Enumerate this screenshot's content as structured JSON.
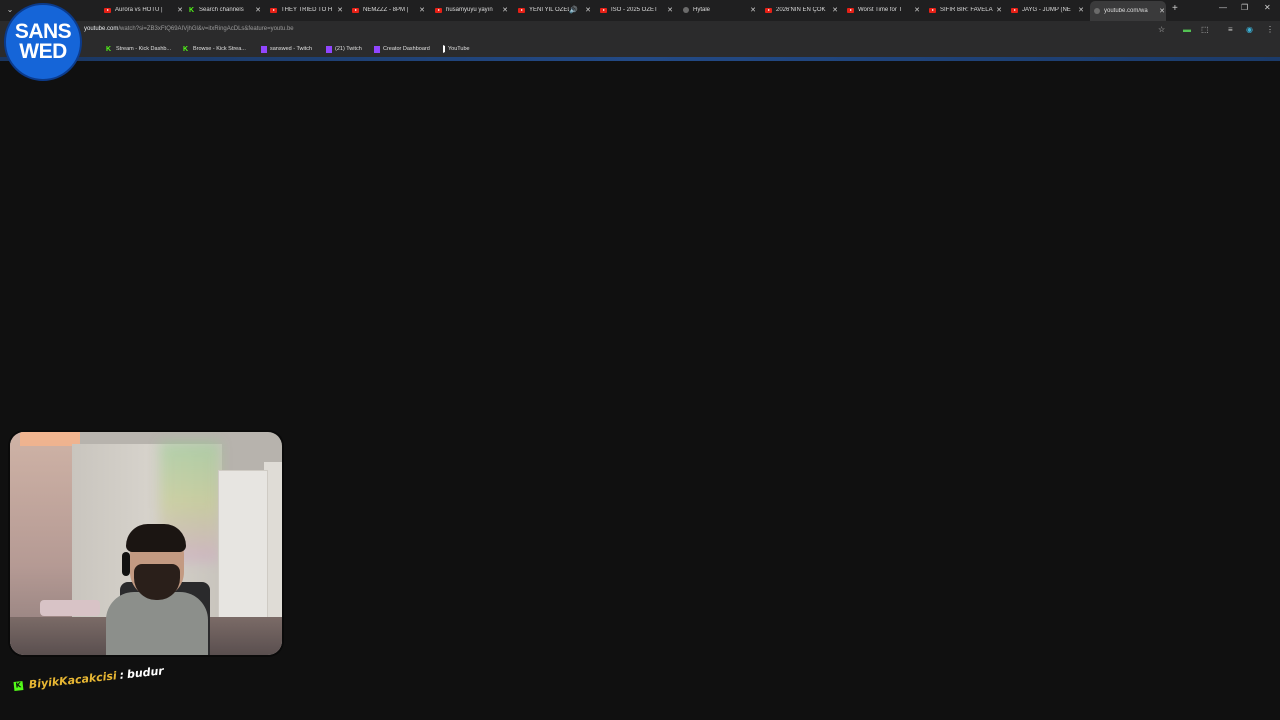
{
  "browser": {
    "tabs": [
      {
        "title": "Aurora vs HOTU |",
        "icon": "youtube-icon"
      },
      {
        "title": "Search channels",
        "icon": "kick-icon"
      },
      {
        "title": "THEY TRIED TO H",
        "icon": "youtube-icon"
      },
      {
        "title": "NEMZZZ - 8PM |",
        "icon": "youtube-icon"
      },
      {
        "title": "husamyuyu yayın",
        "icon": "youtube-icon"
      },
      {
        "title": "YENİ YIL ÖZEL",
        "icon": "youtube-icon",
        "audio": true
      },
      {
        "title": "İSO - 2025 ÖZET",
        "icon": "youtube-icon"
      },
      {
        "title": "Hytale",
        "icon": "hytale-icon"
      },
      {
        "title": "2026'NIN EN ÇOK",
        "icon": "youtube-icon"
      },
      {
        "title": "Worst Time for T",
        "icon": "youtube-icon"
      },
      {
        "title": "SIFIR BİR: FAVELA",
        "icon": "youtube-icon"
      },
      {
        "title": "JAYG - JUMP (NE",
        "icon": "youtube-icon"
      },
      {
        "title": "youtube.com/wa",
        "icon": "loading-icon",
        "active": true
      }
    ],
    "address": {
      "host": "youtube.com",
      "path": "/watch?si=ZB3xFtQ69AIVjhGl&v=itxRingAcDLs&feature=youtu.be"
    },
    "bookmarks": [
      {
        "label": "Stream - Kick Dashb...",
        "icon": "kick-icon"
      },
      {
        "label": "Browse - Kick Strea...",
        "icon": "kick-icon"
      },
      {
        "label": "sanswed - Twitch",
        "icon": "twitch-icon"
      },
      {
        "label": "(21) Twitch",
        "icon": "twitch-icon"
      },
      {
        "label": "Creator Dashboard",
        "icon": "twitch-icon"
      },
      {
        "label": "YouTube",
        "icon": "youtube-icon"
      }
    ]
  },
  "overlay": {
    "logo_line1": "SANS",
    "logo_line2": "WED",
    "chat": {
      "username": "BiyikKacakcisi",
      "separator": ":",
      "message": "budur"
    }
  },
  "colors": {
    "background": "#101010",
    "tabstrip": "#1f1f20",
    "toolbar": "#2b2b2c",
    "logo_blue": "#1565d8",
    "kick_green": "#53fc18",
    "chat_username": "#e8b733"
  }
}
